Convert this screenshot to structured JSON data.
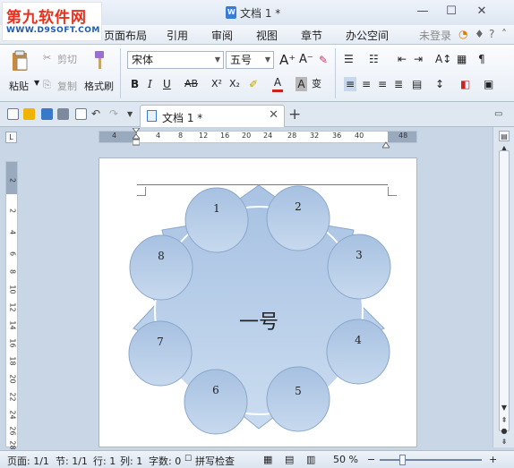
{
  "app": {
    "document_title": "文档 1 *",
    "logo_text": "第九软件网",
    "logo_url_text": "WWW.D9SOFT.COM"
  },
  "window_buttons": [
    "minimize-icon",
    "maximize-icon",
    "close-icon"
  ],
  "menu": {
    "items": [
      "页面布局",
      "引用",
      "审阅",
      "视图",
      "章节",
      "办公空间"
    ],
    "login": "未登录"
  },
  "ribbon": {
    "cut": "剪切",
    "paste": "粘贴",
    "copy": "复制",
    "format_painter": "格式刷",
    "font_name": "宋体",
    "font_size": "五号",
    "bold": "B",
    "italic": "I",
    "underline": "U",
    "strikethrough": "AB",
    "superscript": "X²",
    "subscript": "X₂",
    "font_color": "A",
    "char_shading": "A",
    "phonetic": "变",
    "grow_font": "A⁺",
    "shrink_font": "A⁻"
  },
  "tab": {
    "name": "文档 1 *"
  },
  "hruler_numbers": [
    "4",
    "4",
    "8",
    "12",
    "16",
    "20",
    "24",
    "28",
    "32",
    "36",
    "40",
    "48"
  ],
  "vruler_numbers": [
    "2",
    "2",
    "4",
    "6",
    "8",
    "10",
    "12",
    "14",
    "16",
    "18",
    "20",
    "22",
    "24",
    "26",
    "28"
  ],
  "diagram": {
    "center_text": "一号",
    "nodes": [
      "1",
      "2",
      "3",
      "4",
      "5",
      "6",
      "7",
      "8"
    ],
    "colors": {
      "fill_top": "#a9c3e3",
      "fill_bottom": "#c9dbef",
      "stroke": "#8aa7cc"
    }
  },
  "status": {
    "page": "页面: 1/1",
    "section": "节: 1/1",
    "row": "行: 1",
    "column": "列: 1",
    "word_count": "字数: 0",
    "spell_check": "拼写检查",
    "zoom": "50 %"
  }
}
